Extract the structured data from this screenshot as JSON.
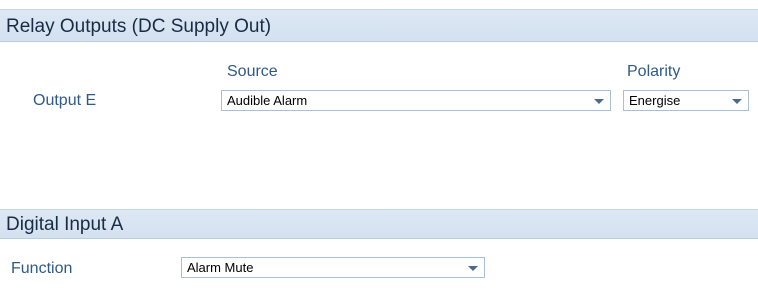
{
  "relay_panel": {
    "title": "Relay Outputs (DC Supply Out)",
    "source_header": "Source",
    "polarity_header": "Polarity",
    "output_label": "Output E",
    "source_value": "Audible Alarm",
    "polarity_value": "Energise"
  },
  "digital_panel": {
    "title": "Digital Input A",
    "function_label": "Function",
    "function_value": "Alarm Mute"
  },
  "colors": {
    "header_bg": "#d9e5f3",
    "label_text": "#2f5a88",
    "combo_border": "#a9bfd6"
  },
  "icons": {
    "dropdown": "chevron-down-icon"
  }
}
